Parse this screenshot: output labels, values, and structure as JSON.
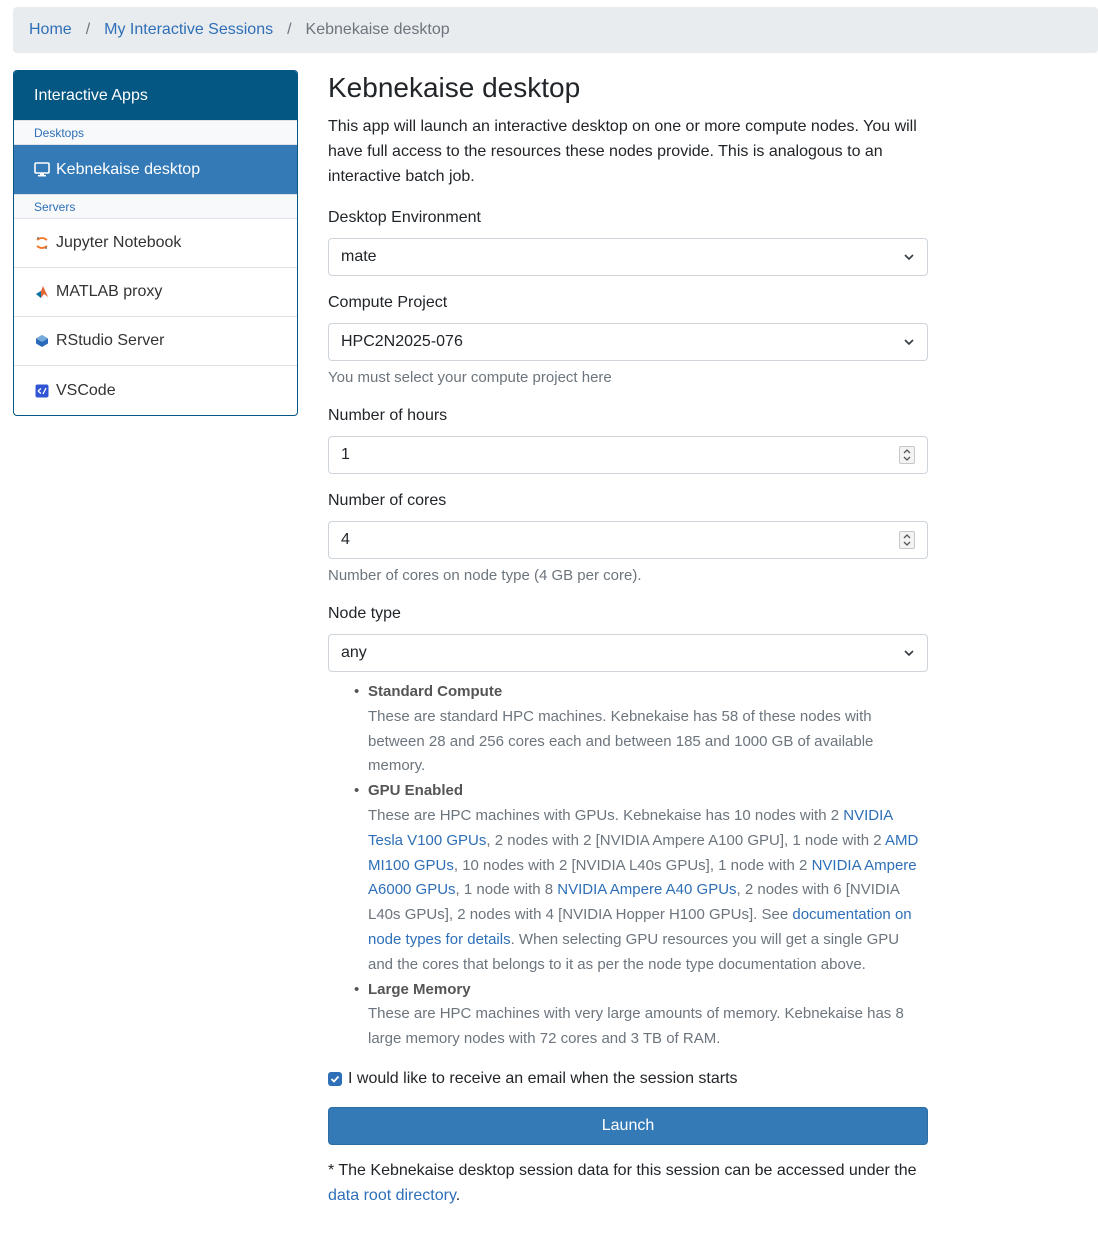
{
  "breadcrumb": {
    "home": "Home",
    "sessions": "My Interactive Sessions",
    "current": "Kebnekaise desktop",
    "sep": "/"
  },
  "sidebar": {
    "header": "Interactive Apps",
    "groups": [
      {
        "label": "Desktops",
        "items": [
          {
            "label": "Kebnekaise desktop",
            "icon": "monitor-icon"
          }
        ]
      },
      {
        "label": "Servers",
        "items": [
          {
            "label": "Jupyter Notebook",
            "icon": "jupyter-icon"
          },
          {
            "label": "MATLAB proxy",
            "icon": "matlab-icon"
          },
          {
            "label": "RStudio Server",
            "icon": "rstudio-icon"
          },
          {
            "label": "VSCode",
            "icon": "vscode-icon"
          }
        ]
      }
    ]
  },
  "form": {
    "title": "Kebnekaise desktop",
    "description": "This app will launch an interactive desktop on one or more compute nodes. You will have full access to the resources these nodes provide. This is analogous to an interactive batch job.",
    "desktop_env": {
      "label": "Desktop Environment",
      "value": "mate"
    },
    "project": {
      "label": "Compute Project",
      "value": "HPC2N2025-076",
      "help": "You must select your compute project here"
    },
    "hours": {
      "label": "Number of hours",
      "value": "1"
    },
    "cores": {
      "label": "Number of cores",
      "value": "4",
      "help": "Number of cores on node type (4 GB per core)."
    },
    "node_type": {
      "label": "Node type",
      "value": "any",
      "std_title": "Standard Compute",
      "std_text": "These are standard HPC machines. Kebnekaise has 58 of these nodes with between 28 and 256 cores each and between 185 and 1000 GB of available memory.",
      "gpu_title": "GPU Enabled",
      "gpu": {
        "t1": "These are HPC machines with GPUs. Kebnekaise has 10 nodes with 2 ",
        "l1": "NVIDIA Tesla V100 GPUs",
        "t2": ", 2 nodes with 2 [NVIDIA Ampere A100 GPU], 1 node with 2 ",
        "l2": "AMD MI100 GPUs",
        "t3": ", 10 nodes with 2 [NVIDIA L40s GPUs], 1 node with 2 ",
        "l3": "NVIDIA Ampere A6000 GPUs",
        "t4": ", 1 node with 8 ",
        "l4": "NVIDIA Ampere A40 GPUs",
        "t5": ", 2 nodes with 6 [NVIDIA L40s GPUs], 2 nodes with 4 [NVIDIA Hopper H100 GPUs]. See ",
        "l5": "documentation on node types for details",
        "t6": ". When selecting GPU resources you will get a single GPU and the cores that belongs to it as per the node type documentation above."
      },
      "mem_title": "Large Memory",
      "mem_text": "These are HPC machines with very large amounts of memory. Kebnekaise has 8 large memory nodes with 72 cores and 3 TB of RAM."
    },
    "email_label": "I would like to receive an email when the session starts",
    "launch_label": "Launch",
    "footnote_text": "* The Kebnekaise desktop session data for this session can be accessed under the ",
    "footnote_link": "data root directory",
    "footnote_end": "."
  },
  "colors": {
    "header": "#045683",
    "active": "#337ab7",
    "link": "#2e6fb7"
  }
}
